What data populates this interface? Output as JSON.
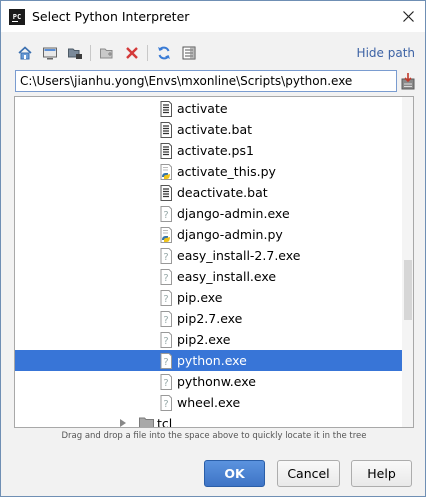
{
  "window": {
    "title": "Select Python Interpreter",
    "app_icon_text": "PC"
  },
  "toolbar": {
    "buttons": [
      "home-icon",
      "desktop-icon",
      "project-folder-icon",
      "new-folder-icon",
      "delete-icon",
      "refresh-icon",
      "show-hidden-icon"
    ],
    "hide_path_label": "Hide path"
  },
  "path": {
    "value": "C:\\Users\\jianhu.yong\\Envs\\mxonline\\Scripts\\python.exe"
  },
  "tree": {
    "items": [
      {
        "name": "activate",
        "icon": "text-file-icon"
      },
      {
        "name": "activate.bat",
        "icon": "text-file-icon"
      },
      {
        "name": "activate.ps1",
        "icon": "text-file-icon"
      },
      {
        "name": "activate_this.py",
        "icon": "python-file-icon"
      },
      {
        "name": "deactivate.bat",
        "icon": "text-file-icon"
      },
      {
        "name": "django-admin.exe",
        "icon": "unknown-file-icon"
      },
      {
        "name": "django-admin.py",
        "icon": "python-file-icon"
      },
      {
        "name": "easy_install-2.7.exe",
        "icon": "unknown-file-icon"
      },
      {
        "name": "easy_install.exe",
        "icon": "unknown-file-icon"
      },
      {
        "name": "pip.exe",
        "icon": "unknown-file-icon"
      },
      {
        "name": "pip2.7.exe",
        "icon": "unknown-file-icon"
      },
      {
        "name": "pip2.exe",
        "icon": "unknown-file-icon"
      },
      {
        "name": "python.exe",
        "icon": "unknown-file-icon",
        "selected": true
      },
      {
        "name": "pythonw.exe",
        "icon": "unknown-file-icon"
      },
      {
        "name": "wheel.exe",
        "icon": "unknown-file-icon"
      }
    ],
    "folder": {
      "name": "tcl",
      "icon": "folder-icon"
    }
  },
  "hint": "Drag and drop a file into the space above to quickly locate it in the tree",
  "buttons": {
    "ok": "OK",
    "cancel": "Cancel",
    "help": "Help"
  },
  "colors": {
    "selection": "#3875d7",
    "link": "#3d63a5",
    "ok_button": "#3e74c6"
  }
}
